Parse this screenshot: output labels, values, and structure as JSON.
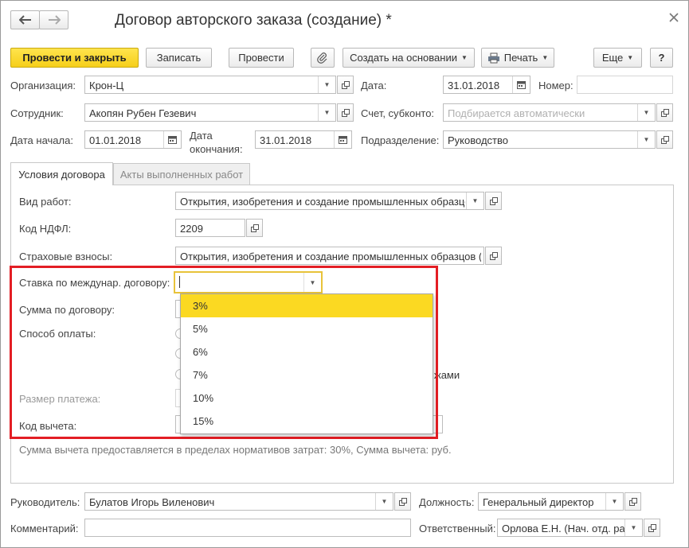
{
  "window": {
    "title": "Договор авторского заказа (создание) *"
  },
  "toolbar": {
    "post_close": "Провести и закрыть",
    "save": "Записать",
    "post": "Провести",
    "create_based": "Создать на основании",
    "print": "Печать",
    "more": "Еще",
    "help": "?"
  },
  "header": {
    "org_label": "Организация:",
    "org_value": "Крон-Ц",
    "date_label": "Дата:",
    "date_value": "31.01.2018",
    "number_label": "Номер:",
    "number_value": "",
    "employee_label": "Сотрудник:",
    "employee_value": "Акопян Рубен Гезевич",
    "account_label": "Счет, субконто:",
    "account_placeholder": "Подбирается автоматически",
    "start_label": "Дата начала:",
    "start_value": "01.01.2018",
    "end_label_1": "Дата",
    "end_label_2": "окончания:",
    "end_value": "31.01.2018",
    "dept_label": "Подразделение:",
    "dept_value": "Руководство"
  },
  "tabs": [
    {
      "label": "Условия договора"
    },
    {
      "label": "Акты выполненных работ"
    }
  ],
  "terms": {
    "work_type_label": "Вид работ:",
    "work_type_value": "Открытия, изобретения и создание промышленных образцов",
    "ndfl_label": "Код НДФЛ:",
    "ndfl_value": "2209",
    "insurance_label": "Страховые взносы:",
    "insurance_value": "Открытия, изобретения и создание промышленных образцов (п",
    "rate_label": "Ставка по междунар. договору:",
    "rate_value": "",
    "sum_label": "Сумма по договору:",
    "payment_label": "Способ оплаты:",
    "payment_tail": "жами",
    "payment_size_label": "Размер платежа:",
    "deduction_label": "Код вычета:",
    "note": "Сумма вычета предоставляется в пределах нормативов затрат: 30%,  Сумма вычета:  руб."
  },
  "dropdown": {
    "options": [
      "3%",
      "5%",
      "6%",
      "7%",
      "10%",
      "15%"
    ],
    "selected": "3%"
  },
  "footer": {
    "manager_label": "Руководитель:",
    "manager_value": "Булатов Игорь Виленович",
    "position_label": "Должность:",
    "position_value": "Генеральный директор",
    "comment_label": "Комментарий:",
    "comment_value": "",
    "responsible_label": "Ответственный:",
    "responsible_value": "Орлова Е.Н. (Нач. отд. ра"
  },
  "colors": {
    "accent": "#f6cf1a",
    "highlight_border": "#e31e24",
    "selected_item": "#fbd922",
    "focus_border": "#e8c33a"
  }
}
